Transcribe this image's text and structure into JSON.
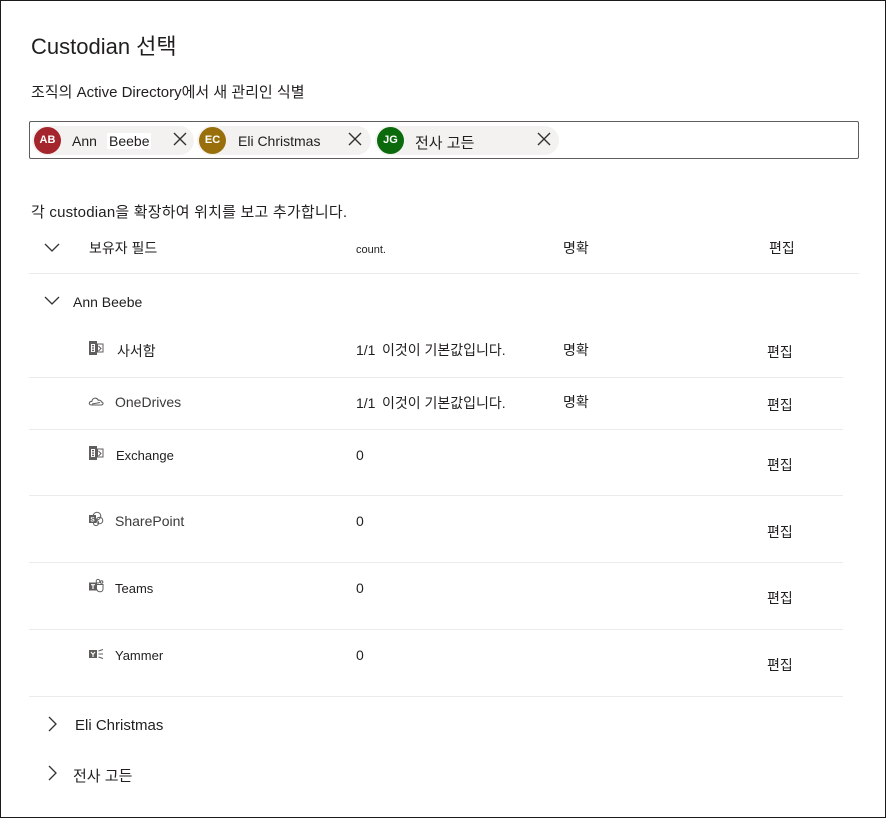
{
  "dialog": {
    "title": "Custodian 선택",
    "subtitle": "조직의 Active Directory에서 새 관리인 식별",
    "instructions": "각 custodian을 확장하여 위치를 보고 추가합니다."
  },
  "picker": {
    "pills": [
      {
        "initials": "AB",
        "name_first": "Ann",
        "name_last": "Beebe",
        "color": "#a4262c"
      },
      {
        "initials": "EC",
        "name": "Eli Christmas",
        "color": "#986f0b"
      },
      {
        "initials": "JG",
        "name": "전사 고든",
        "color": "#0b6a0b"
      }
    ]
  },
  "table": {
    "headers": {
      "name": "보유자 필드",
      "count": "count.",
      "clear": "명확",
      "edit": "편집"
    },
    "groups": [
      {
        "name": "Ann Beebe",
        "expanded": true,
        "rows": [
          {
            "icon": "exchange-mailbox-icon",
            "label": "사서함",
            "count": "1/1",
            "status": "이것이 기본값입니다.",
            "clear": "명확",
            "edit": "편집"
          },
          {
            "icon": "onedrive-cloud-icon",
            "label": "OneDrives",
            "count": "1/1",
            "status": "이것이 기본값입니다.",
            "clear": "명확",
            "edit": "편집"
          },
          {
            "icon": "exchange-icon",
            "label": "Exchange",
            "count": "0",
            "edit": "편집"
          },
          {
            "icon": "sharepoint-icon",
            "label": "SharePoint",
            "count": "0",
            "edit": "편집"
          },
          {
            "icon": "teams-icon",
            "label": "Teams",
            "count": "0",
            "edit": "편집"
          },
          {
            "icon": "yammer-icon",
            "label": "Yammer",
            "count": "0",
            "edit": "편집"
          }
        ]
      },
      {
        "name": "Eli Christmas",
        "expanded": false
      },
      {
        "name": "전사 고든",
        "expanded": false
      }
    ]
  }
}
